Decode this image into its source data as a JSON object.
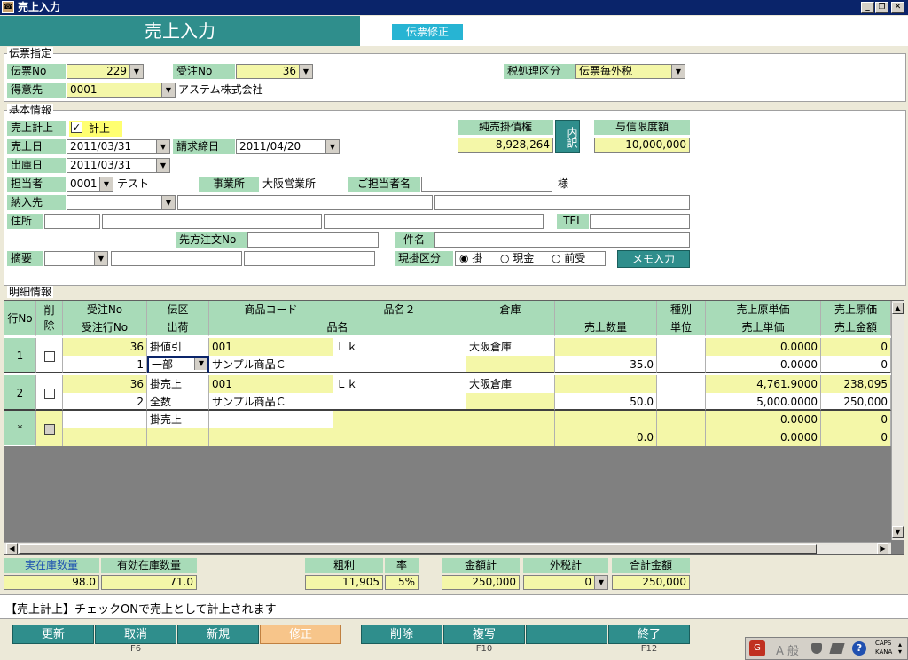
{
  "window": {
    "title": "売上入力",
    "app_icon": "app-icon"
  },
  "header": {
    "title": "売上入力",
    "mode": "伝票修正"
  },
  "denpyo": {
    "group_title": "伝票指定",
    "denpyo_no_label": "伝票No",
    "denpyo_no": "229",
    "juchu_no_label": "受注No",
    "juchu_no": "36",
    "tax_label": "税処理区分",
    "tax_value": "伝票毎外税",
    "tokui_label": "得意先",
    "tokui_code": "0001",
    "tokui_name": "アステム株式会社"
  },
  "kihon": {
    "group_title": "基本情報",
    "uriage_keijo_label": "売上計上",
    "keijo_check_label": "計上",
    "uriage_date_label": "売上日",
    "uriage_date": "2011/03/31",
    "seikyu_label": "請求締日",
    "seikyu_date": "2011/04/20",
    "shukko_label": "出庫日",
    "shukko_date": "2011/03/31",
    "tanto_label": "担当者",
    "tanto_code": "0001",
    "tanto_name": "テスト",
    "jigyo_label": "事業所",
    "jigyo_value": "大阪営業所",
    "gotanto_label": "ご担当者名",
    "sama": "様",
    "nonyu_label": "納入先",
    "jusho_label": "住所",
    "tel_label": "TEL",
    "sakikata_label": "先方注文No",
    "kenmei_label": "件名",
    "tekiyo_label": "摘要",
    "genkake_label": "現掛区分",
    "radio_kake": "掛",
    "radio_genkin": "現金",
    "radio_maeuke": "前受",
    "memo_button": "メモ入力",
    "junbai_label": "純売掛債権",
    "junbai_value": "8,928,264",
    "uchiwake_button": "内訳",
    "yoshin_label": "与信限度額",
    "yoshin_value": "10,000,000"
  },
  "meisai": {
    "group_title": "明細情報",
    "headers": {
      "gyo_no": "行No",
      "sakujo": "削除",
      "juchu_no": "受注No",
      "juchu_gyo": "受注行No",
      "denku": "伝区",
      "shukka": "出荷",
      "shohin_code": "商品コード",
      "hinmei2": "品名２",
      "hinmei": "品名",
      "soko": "倉庫",
      "uriage_suryo": "売上数量",
      "shubetsu": "種別",
      "tani": "単位",
      "genka_tanka": "売上原単価",
      "uriage_tanka": "売上単価",
      "genka": "売上原価",
      "uriage_kingaku": "売上金額"
    },
    "rows": [
      {
        "no": "1",
        "juchu_no": "36",
        "juchu_gyo": "1",
        "denku": "掛値引",
        "shukka": "一部",
        "code": "001",
        "hinmei2": "Ｌｋ",
        "hinmei": "サンプル商品Ｃ",
        "soko": "大阪倉庫",
        "suryo": "35.0",
        "genka_tanka": "0.0000",
        "tanka": "0.0000",
        "genka": "0",
        "kingaku": "0"
      },
      {
        "no": "2",
        "juchu_no": "36",
        "juchu_gyo": "2",
        "denku": "掛売上",
        "shukka": "全数",
        "code": "001",
        "hinmei2": "Ｌｋ",
        "hinmei": "サンプル商品Ｃ",
        "soko": "大阪倉庫",
        "suryo": "50.0",
        "genka_tanka": "4,761.9000",
        "tanka": "5,000.0000",
        "genka": "238,095",
        "kingaku": "250,000"
      },
      {
        "no": "*",
        "juchu_no": "",
        "juchu_gyo": "",
        "denku": "掛売上",
        "shukka": "",
        "code": "",
        "hinmei2": "",
        "hinmei": "",
        "soko": "",
        "suryo": "0.0",
        "genka_tanka": "0.0000",
        "tanka": "0.0000",
        "genka": "0",
        "kingaku": "0"
      }
    ]
  },
  "summary": {
    "jitsu_label": "実在庫数量",
    "jitsu_value": "98.0",
    "yuko_label": "有効在庫数量",
    "yuko_value": "71.0",
    "arari_label": "粗利",
    "arari_value": "11,905",
    "ritsu_label": "率",
    "ritsu_value": "5%",
    "kingaku_label": "金額計",
    "kingaku_value": "250,000",
    "gaizei_label": "外税計",
    "gaizei_value": "0",
    "gokei_label": "合計金額",
    "gokei_value": "250,000"
  },
  "status": {
    "message": "【売上計上】チェックONで売上として計上されます"
  },
  "fkeys": [
    {
      "label": "更新",
      "sub": ""
    },
    {
      "label": "取消",
      "sub": "F6"
    },
    {
      "label": "新規",
      "sub": ""
    },
    {
      "label": "修正",
      "sub": ""
    },
    {
      "label": "削除",
      "sub": ""
    },
    {
      "label": "複写",
      "sub": "F10"
    },
    {
      "label": "",
      "sub": ""
    },
    {
      "label": "終了",
      "sub": "F12"
    }
  ],
  "tray": {
    "ime_text": "A 般",
    "caps": "CAPS",
    "kana": "KANA"
  }
}
